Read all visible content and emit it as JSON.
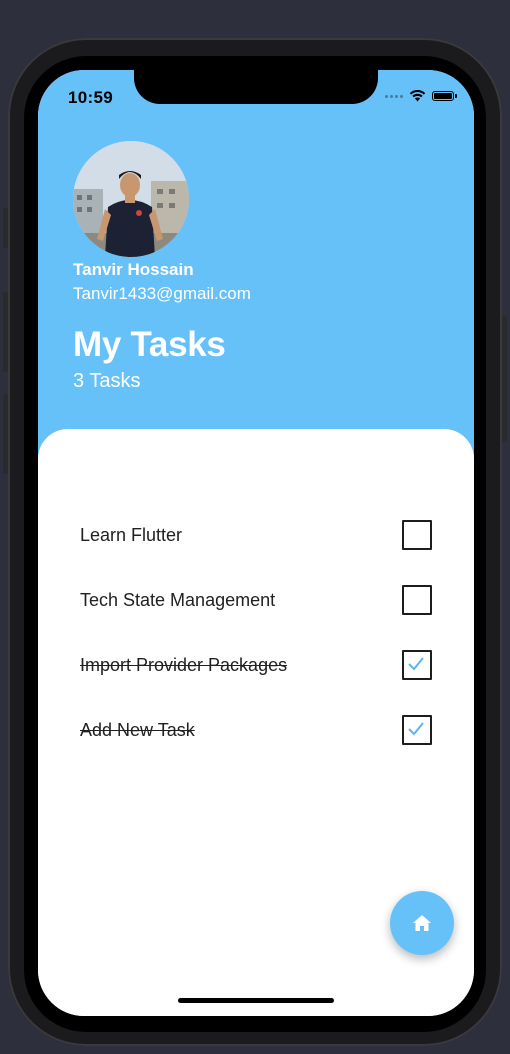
{
  "status_bar": {
    "time": "10:59",
    "wifi_icon": "wifi-icon",
    "battery_icon": "battery-icon"
  },
  "profile": {
    "avatar_icon": "profile-photo",
    "name": "Tanvir Hossain",
    "email": "Tanvir1433@gmail.com"
  },
  "header": {
    "title": "My Tasks",
    "count": "3 Tasks"
  },
  "tasks": [
    {
      "label": "Learn Flutter",
      "done": false
    },
    {
      "label": "Tech State Management",
      "done": false
    },
    {
      "label": "Import Provider Packages",
      "done": true
    },
    {
      "label": "Add New Task",
      "done": true
    }
  ],
  "fab": {
    "icon": "home-icon"
  },
  "colors": {
    "accent": "#67c1f9",
    "check": "#5bb6f0",
    "background": "#2d2f3c"
  }
}
